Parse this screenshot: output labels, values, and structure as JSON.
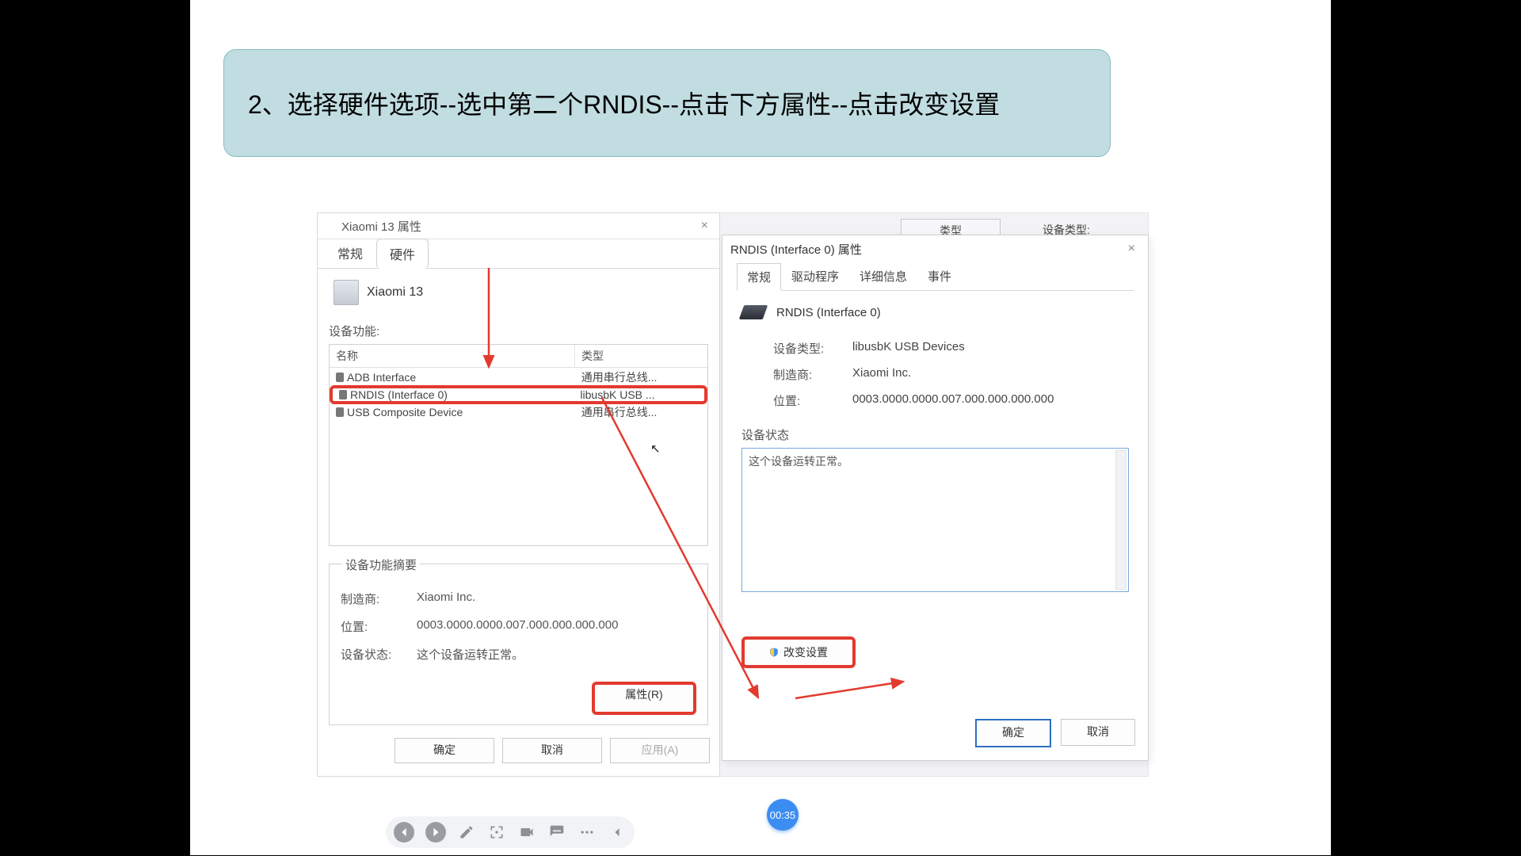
{
  "instruction": "2、选择硬件选项--选中第二个RNDIS--点击下方属性--点击改变设置",
  "timestamp": "00:35",
  "bg": {
    "tab": "类型",
    "label": "设备类型:"
  },
  "win1": {
    "title": "Xiaomi 13 属性",
    "tabs": {
      "general": "常规",
      "hardware": "硬件"
    },
    "device_name": "Xiaomi 13",
    "list_title": "设备功能:",
    "cols": {
      "name": "名称",
      "type": "类型"
    },
    "rows": [
      {
        "name": "ADB Interface",
        "type": "通用串行总线..."
      },
      {
        "name": "RNDIS (Interface 0)",
        "type": "libusbK USB ..."
      },
      {
        "name": "USB Composite Device",
        "type": "通用串行总线..."
      }
    ],
    "summary": {
      "title": "设备功能摘要",
      "manu_k": "制造商:",
      "manu_v": "Xiaomi Inc.",
      "loc_k": "位置:",
      "loc_v": "0003.0000.0000.007.000.000.000.000",
      "stat_k": "设备状态:",
      "stat_v": "这个设备运转正常。"
    },
    "buttons": {
      "prop": "属性(R)",
      "ok": "确定",
      "cancel": "取消",
      "apply": "应用(A)"
    }
  },
  "win2": {
    "title": "RNDIS (Interface 0) 属性",
    "tabs": {
      "general": "常规",
      "driver": "驱动程序",
      "detail": "详细信息",
      "event": "事件"
    },
    "device_name": "RNDIS (Interface 0)",
    "kv": {
      "type_k": "设备类型:",
      "type_v": "libusbK USB Devices",
      "manu_k": "制造商:",
      "manu_v": "Xiaomi Inc.",
      "loc_k": "位置:",
      "loc_v": "0003.0000.0000.007.000.000.000.000"
    },
    "status_label": "设备状态",
    "status_text": "这个设备运转正常。",
    "change_btn": "改变设置",
    "ok": "确定",
    "cancel": "取消"
  }
}
